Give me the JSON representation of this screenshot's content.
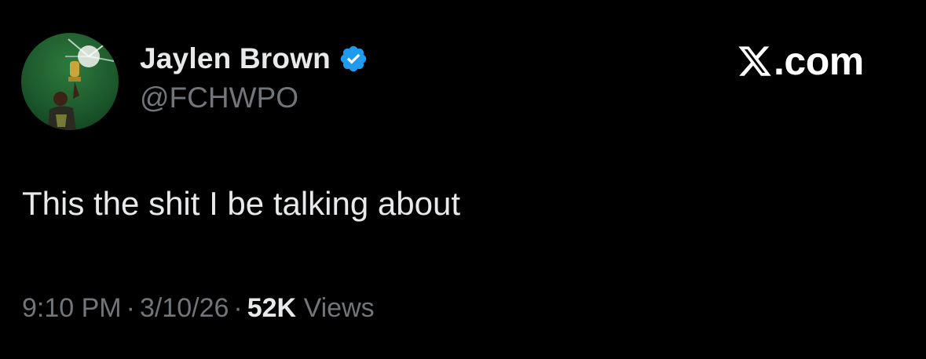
{
  "user": {
    "display_name": "Jaylen Brown",
    "handle": "@FCHWPO",
    "verified": true,
    "avatar_icon": "avatar-player-holding-trophy"
  },
  "brand": {
    "logo_icon": "x-logo-icon",
    "text": ".com"
  },
  "tweet": {
    "text": "This the shit I be talking about"
  },
  "meta": {
    "time": "9:10 PM",
    "separator": "·",
    "date": "3/10/26",
    "views_count": "52K",
    "views_label": "Views"
  },
  "colors": {
    "background": "#000000",
    "primary_text": "#e7e9ea",
    "secondary_text": "#71767b",
    "verified_blue": "#1d9bf0"
  }
}
